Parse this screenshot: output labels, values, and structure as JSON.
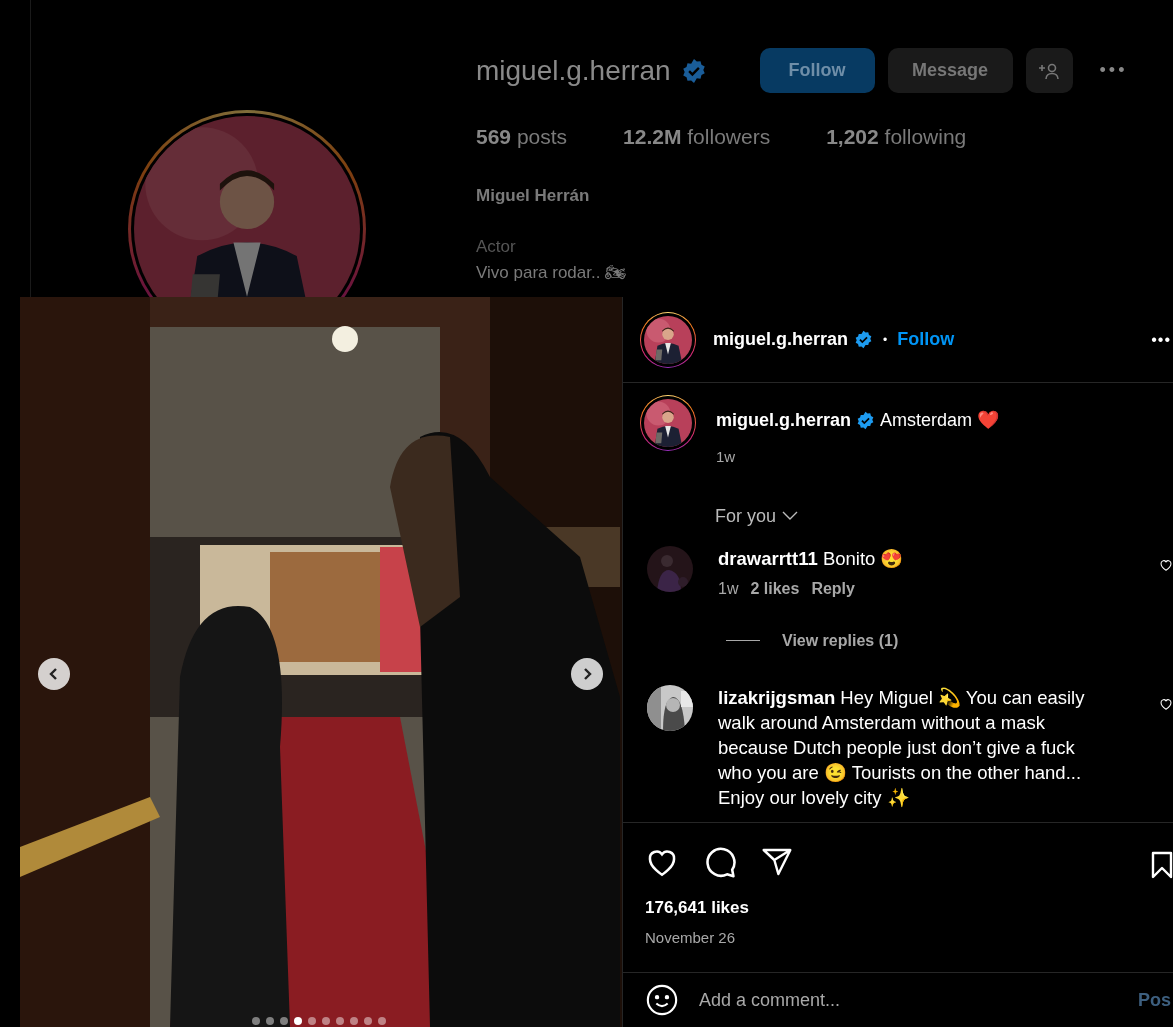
{
  "profile": {
    "username": "miguel.g.herran",
    "verified": true,
    "actions": [
      {
        "kind": "follow",
        "label": "Follow"
      },
      {
        "kind": "message",
        "label": "Message"
      },
      {
        "kind": "add-person"
      },
      {
        "kind": "more",
        "label": "•••"
      }
    ],
    "stats": [
      "**569** posts",
      "**12.2M** followers",
      "**1,202** following"
    ],
    "full_name": "Miguel Herrán",
    "category": "Actor",
    "bio": [
      "Vivo para rodar.. 🏍"
    ]
  },
  "post": {
    "slides": [
      {
        "selected": false
      },
      {
        "selected": false
      },
      {
        "selected": false
      },
      {
        "selected": true
      },
      {
        "selected": false
      },
      {
        "selected": false
      },
      {
        "selected": false
      },
      {
        "selected": false
      },
      {
        "selected": false
      },
      {
        "selected": false
      }
    ],
    "header": {
      "username": "miguel.g.herran",
      "verified": true,
      "separator": "•",
      "follow": "Follow",
      "more": "•••"
    },
    "caption": {
      "username": "miguel.g.herran",
      "verified": true,
      "text": "Amsterdam ❤️",
      "time": "1w"
    },
    "sort": "For you",
    "comments": [
      {
        "text": "**drawarrtt11** Bonito 😍",
        "meta": [
          "1w",
          "2 likes",
          "Reply"
        ],
        "replies": "View replies (1)",
        "liked": false
      },
      {
        "text": "**lizakrijgsman** Hey Miguel 💫 You can easily walk around Amsterdam without a mask because Dutch people just don’t give a fuck who you are 😉 Tourists on the other hand... Enjoy our lovely city ✨",
        "liked": false
      }
    ],
    "liked": false,
    "saved": false,
    "likes": "176,641 likes",
    "date": "November 26",
    "comment_box": {
      "placeholder": "Add a comment...",
      "post": "Pos"
    }
  }
}
